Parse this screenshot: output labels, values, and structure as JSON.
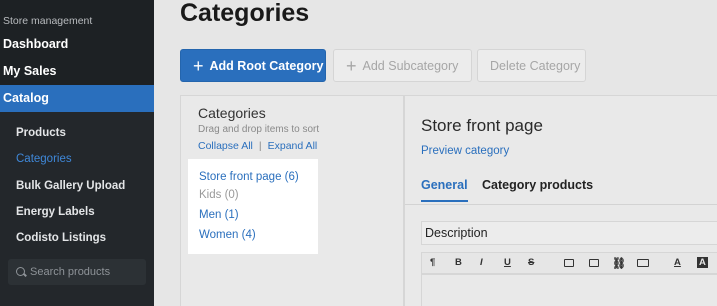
{
  "sidebar": {
    "section_label": "Store management",
    "main_items": [
      {
        "label": "Dashboard"
      },
      {
        "label": "My Sales"
      },
      {
        "label": "Catalog"
      }
    ],
    "sub_items": [
      {
        "label": "Products"
      },
      {
        "label": "Categories"
      },
      {
        "label": "Bulk Gallery Upload"
      },
      {
        "label": "Energy Labels"
      },
      {
        "label": "Codisto Listings"
      }
    ],
    "search_placeholder": "Search products"
  },
  "page": {
    "title": "Categories"
  },
  "toolbar": {
    "add_root": "Add Root Category",
    "add_sub": "Add Subcategory",
    "delete": "Delete Category"
  },
  "tree": {
    "title": "Categories",
    "hint": "Drag and drop items to sort",
    "collapse_all": "Collapse All",
    "separator": "|",
    "expand_all": "Expand All",
    "items": [
      {
        "label": "Store front page (6)"
      },
      {
        "label": "Kids (0)"
      },
      {
        "label": "Men (1)"
      },
      {
        "label": "Women (4)"
      }
    ]
  },
  "detail": {
    "title": "Store front page",
    "preview_link": "Preview category",
    "tabs": [
      {
        "label": "General"
      },
      {
        "label": "Category products"
      }
    ],
    "description_label": "Description",
    "editor_tools": [
      "¶",
      "B",
      "I",
      "U",
      "S"
    ]
  },
  "colors": {
    "accent": "#2a6fbd",
    "sidebar_bg": "#1d2124"
  }
}
